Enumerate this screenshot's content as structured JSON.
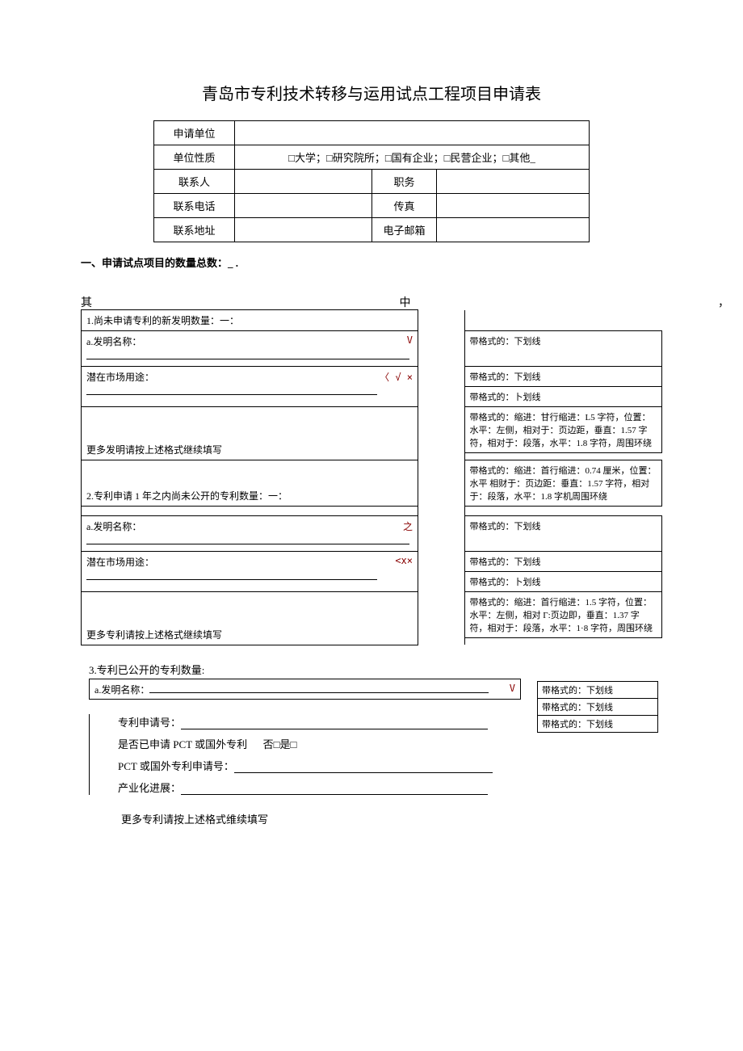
{
  "title": "青岛市专利技术转移与运用试点工程项目申请表",
  "info": {
    "applicant_unit_label": "申请单位",
    "unit_nature_label": "单位性质",
    "unit_nature_options": "□大学；□研究院所；□国有企业；□民营企业；□其他_",
    "contact_person_label": "联系人",
    "position_label": "职务",
    "phone_label": "联系电话",
    "fax_label": "传真",
    "address_label": "联系地址",
    "email_label": "电子邮箱"
  },
  "section_count": "一、申请试点项目的数量总数：_ .",
  "among_label": "其",
  "among_mid": "中",
  "among_end": "，",
  "sec1": {
    "header": "1.尚未申请专利的新发明数量：一：",
    "name_label": "a.发明名称："
  },
  "potential_use": "潜在市场用途：",
  "more_inventions": "更多发明请按上述格式继续填写",
  "sec2": {
    "header": "2.专利申请 1 年之内尚未公开的专利数量：一：",
    "name_label": "a.发明名称："
  },
  "more_patents": "更多专利请按上述格式继续填写",
  "notes": {
    "underline": "带格式的：下划线",
    "underline_alt": "带格式的：卜划线",
    "indent1": "带格式的：缩进：甘行缩进：L5 字符，位置：水平：左侧，相对于：页边距，垂直：1.57 字符，相对于：段落，水平：1.8 字符，周围环绕",
    "indent2": "带格式的：缩进：首行缩进：0.74 厘米，位置：水平 相财于：页边距：垂直：1.57 字符，相对于：段落，水平：1.8 字机周围环绕",
    "indent3": "带格式的：缩进：首行缩进：1.5 字符，位置：水平：左侧，相对 Γ:页边即，垂直：1.37 字符，相对于：段落，水平：1·8 字符，周围环绕"
  },
  "markers": {
    "v": "V",
    "check_x": "〈 √ ×",
    "zhi": "之",
    "xx": "<x×"
  },
  "sec3": {
    "header": "3.专利已公开的专利数量:",
    "name_label": "a.发明名称：",
    "app_no": "专利申请号：",
    "pct_q": "是否已申请 PCT 或国外专利",
    "pct_opts": "否□是□",
    "pct_no": "PCT 或国外专利申请号：",
    "progress": "产业化进展：",
    "more": "更多专利请按上述格式维续填写"
  }
}
